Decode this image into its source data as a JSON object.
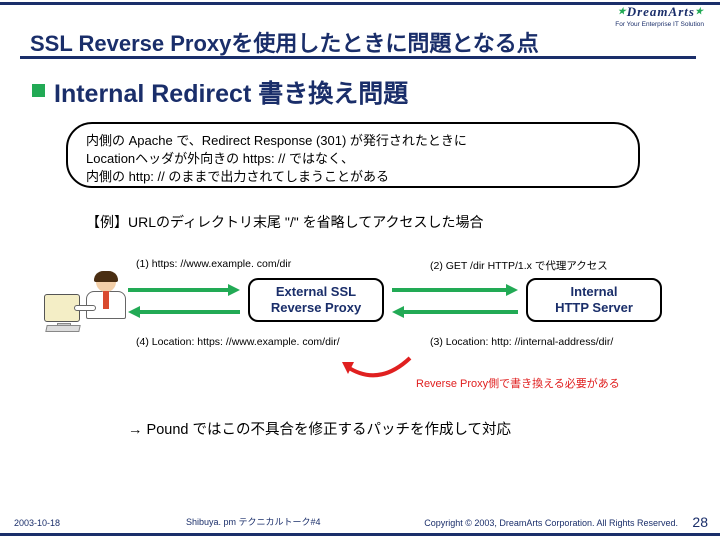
{
  "brand": {
    "name": "DreamArts",
    "tagline": "For Your Enterprise IT Solution"
  },
  "title": "SSL Reverse Proxyを使用したときに問題となる点",
  "h2": "Internal Redirect 書き換え問題",
  "box_text": "内側の Apache で、Redirect Response (301) が発行されたときに\nLocationヘッダが外向きの https: // ではなく、\n内側の http: // のままで出力されてしまうことがある",
  "example_label": "【例】URLのディレクトリ末尾 \"/\" を省略してアクセスした場合",
  "flow": {
    "step1": "(1) https: //www.example. com/dir",
    "step2": "(2) GET /dir HTTP/1.x で代理アクセス",
    "step3": "(3) Location: http: //internal-address/dir/",
    "step4": "(4) Location: https: //www.example. com/dir/",
    "proxy_label": "External SSL\nReverse Proxy",
    "server_label": "Internal\nHTTP Server"
  },
  "red_note": "Reverse Proxy側で書き換える必要がある",
  "conclusion": "→ Pound ではこの不具合を修正するパッチを作成して対応",
  "footer": {
    "date": "2003-10-18",
    "mid": "Shibuya. pm テクニカルトーク#4",
    "copy": "Copyright © 2003, DreamArts Corporation. All Rights Reserved.",
    "page": "28"
  }
}
